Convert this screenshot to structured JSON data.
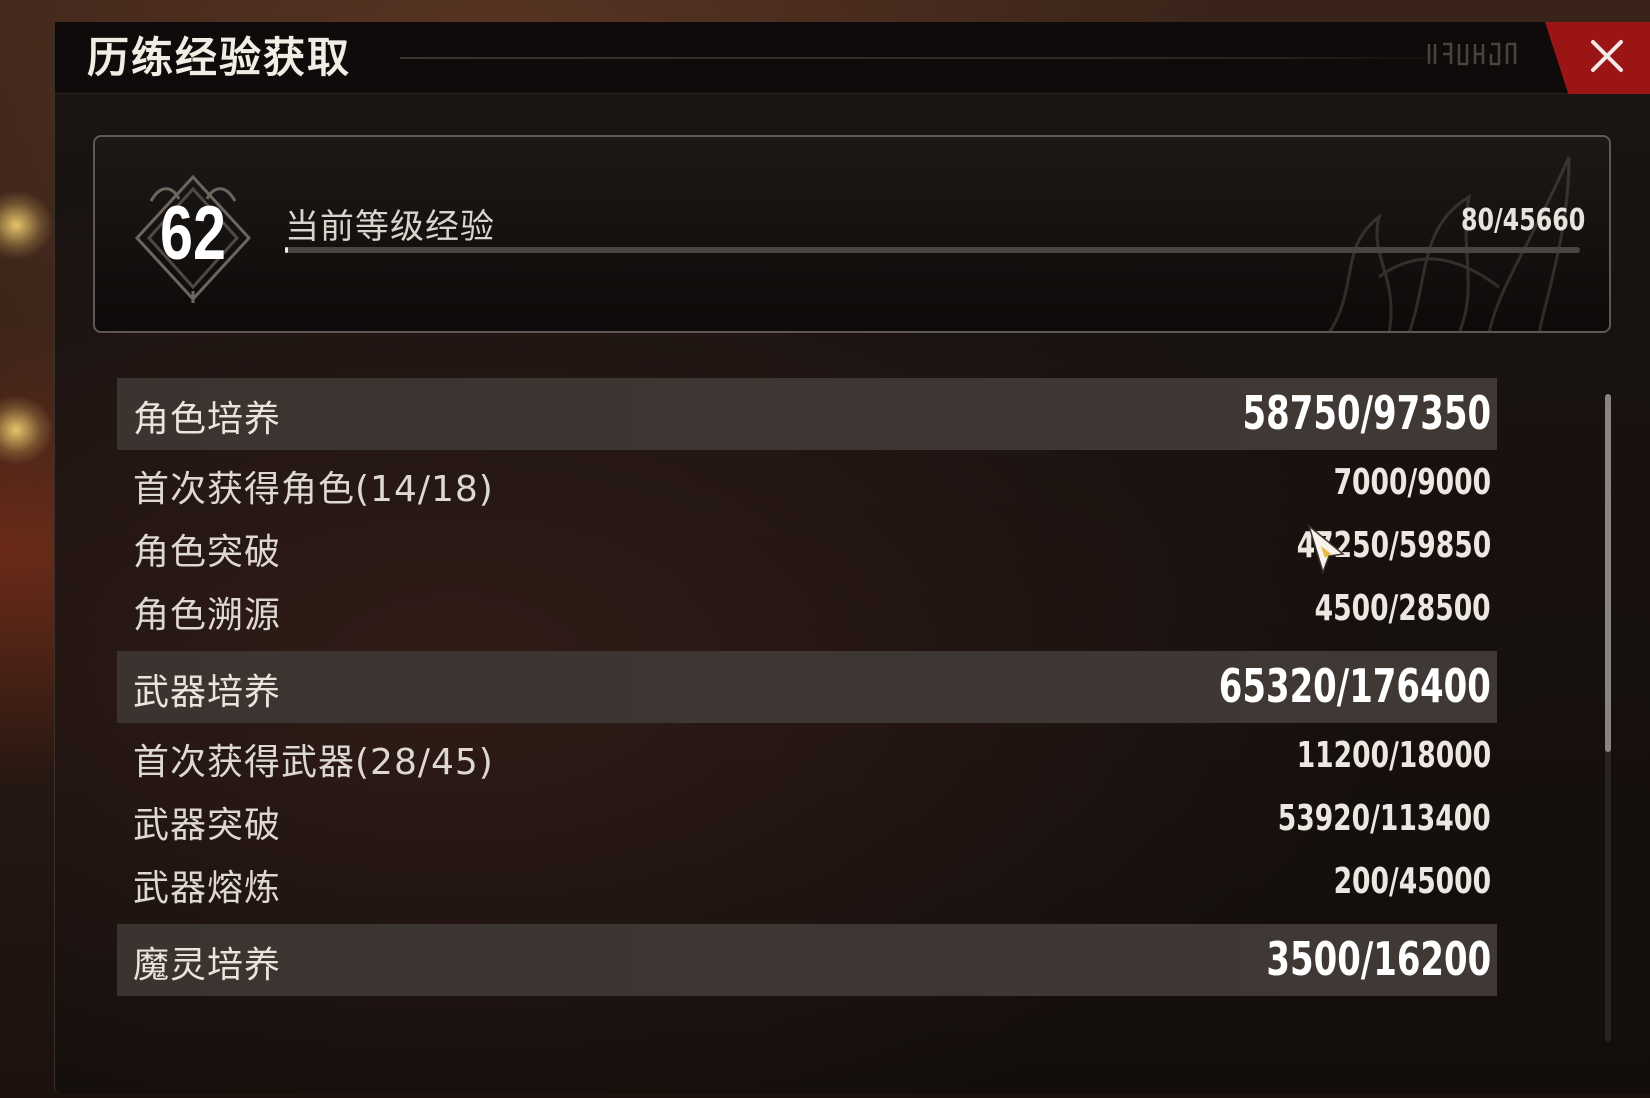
{
  "window": {
    "title": "历练经验获取",
    "header_glyphs": "ꟷꞮꞮꟷ ꞮꞮ"
  },
  "level": {
    "number": "62",
    "label": "当前等级经验",
    "value": "80/45660",
    "progress_fraction": 0.0018
  },
  "groups": [
    {
      "name": "角色培养",
      "value": "58750/97350",
      "items": [
        {
          "name": "首次获得角色(14/18)",
          "value": "7000/9000"
        },
        {
          "name": "角色突破",
          "value": "47250/59850"
        },
        {
          "name": "角色溯源",
          "value": "4500/28500"
        }
      ]
    },
    {
      "name": "武器培养",
      "value": "65320/176400",
      "items": [
        {
          "name": "首次获得武器(28/45)",
          "value": "11200/18000"
        },
        {
          "name": "武器突破",
          "value": "53920/113400"
        },
        {
          "name": "武器熔炼",
          "value": "200/45000"
        }
      ]
    },
    {
      "name": "魔灵培养",
      "value": "3500/16200",
      "items": []
    }
  ],
  "icons": {
    "close": "close-icon",
    "level_badge": "ornate-diamond-badge-icon",
    "cursor": "pointer-cursor-icon"
  },
  "colors": {
    "close_accent": "#9c1515",
    "panel_bg": "#15100e",
    "group_header_bg": "#3c3431",
    "text_primary": "#ffffff"
  }
}
